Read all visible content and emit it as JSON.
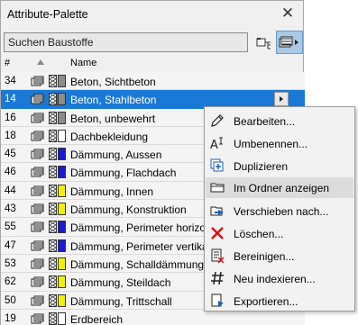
{
  "palette": {
    "title": "Attribute-Palette",
    "search_value": "Suchen Baustoffe"
  },
  "header": {
    "num": "#",
    "name": "Name"
  },
  "rows": [
    {
      "num": "34",
      "name": "Beton, Sichtbeton",
      "color": "#8c8c8c",
      "selected": false
    },
    {
      "num": "14",
      "name": "Beton, Stahlbeton",
      "color": "#8c8c8c",
      "selected": true
    },
    {
      "num": "16",
      "name": "Beton, unbewehrt",
      "color": "#8c8c8c",
      "selected": false
    },
    {
      "num": "18",
      "name": "Dachbekleidung",
      "color": "#ffffff",
      "selected": false
    },
    {
      "num": "45",
      "name": "Dämmung, Aussen",
      "color": "#1b1bd0",
      "selected": false
    },
    {
      "num": "46",
      "name": "Dämmung, Flachdach",
      "color": "#1b1bd0",
      "selected": false
    },
    {
      "num": "44",
      "name": "Dämmung, Innen",
      "color": "#f2f200",
      "selected": false
    },
    {
      "num": "43",
      "name": "Dämmung, Konstruktion",
      "color": "#f2f200",
      "selected": false
    },
    {
      "num": "55",
      "name": "Dämmung, Perimeter horizon",
      "color": "#1b1bd0",
      "selected": false
    },
    {
      "num": "47",
      "name": "Dämmung, Perimeter vertikal",
      "color": "#1b1bd0",
      "selected": false
    },
    {
      "num": "53",
      "name": "Dämmung, Schalldämmung",
      "color": "#f2f200",
      "selected": false
    },
    {
      "num": "62",
      "name": "Dämmung, Steildach",
      "color": "#f2f200",
      "selected": false
    },
    {
      "num": "50",
      "name": "Dämmung, Trittschall",
      "color": "#f2f200",
      "selected": false
    },
    {
      "num": "19",
      "name": "Erdbereich",
      "color": "#ffffff",
      "selected": false
    }
  ],
  "menu": {
    "items": [
      {
        "label": "Bearbeiten...",
        "icon": "pencil-icon"
      },
      {
        "label": "Umbenennen...",
        "icon": "rename-text-icon"
      },
      {
        "label": "Duplizieren",
        "icon": "duplicate-icon"
      },
      {
        "label": "Im Ordner anzeigen",
        "icon": "folder-icon",
        "highlighted": true
      },
      {
        "label": "Verschieben nach...",
        "icon": "move-icon"
      },
      {
        "label": "Löschen...",
        "icon": "delete-x-icon"
      },
      {
        "label": "Bereinigen...",
        "icon": "purge-icon"
      },
      {
        "label": "Neu indexieren...",
        "icon": "hash-icon"
      },
      {
        "label": "Exportieren...",
        "icon": "export-icon"
      }
    ]
  }
}
